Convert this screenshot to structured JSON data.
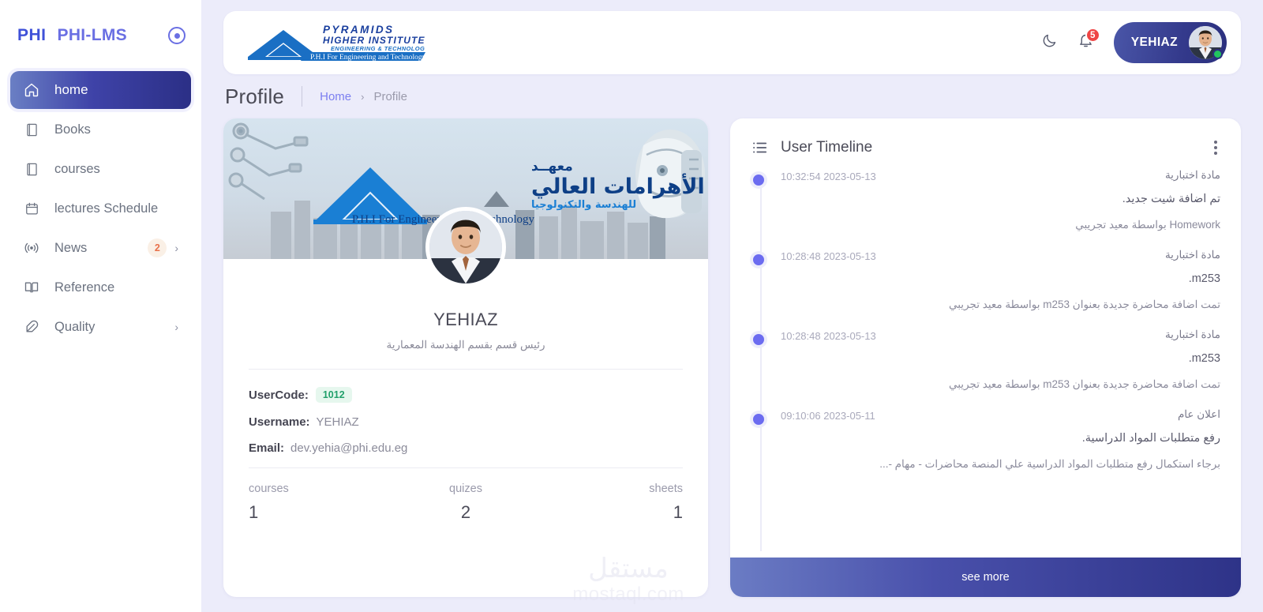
{
  "sidebar": {
    "brand_short": "PHI",
    "brand_name": "PHI-LMS",
    "collapse_icon": "circle-dot-icon",
    "items": [
      {
        "label": "home",
        "icon": "home-icon",
        "active": true
      },
      {
        "label": "Books",
        "icon": "book-icon",
        "active": false
      },
      {
        "label": "courses",
        "icon": "book-icon",
        "active": false
      },
      {
        "label": "lectures Schedule",
        "icon": "calendar-icon",
        "active": false
      },
      {
        "label": "News",
        "icon": "broadcast-icon",
        "active": false,
        "badge": "2",
        "chevron": "chevron-right-icon"
      },
      {
        "label": "Reference",
        "icon": "open-book-icon",
        "active": false
      },
      {
        "label": "Quality",
        "icon": "feather-icon",
        "active": false,
        "chevron": "chevron-right-icon"
      }
    ]
  },
  "topbar": {
    "logo": {
      "line1": "PYRAMIDS",
      "line2": "HIGHER INSTITUTE",
      "line3": "ENGINEERING & TECHNOLOGY",
      "line4": "P.H.I For Engineering and Technology"
    },
    "dark_mode_icon": "moon-icon",
    "notifications_icon": "bell-icon",
    "notifications_count": "5",
    "user_name": "YEHIAZ",
    "avatar": "user-avatar",
    "status": "online"
  },
  "breadcrumb": {
    "page_title": "Profile",
    "home": "Home",
    "separator": "›",
    "current": "Profile"
  },
  "profile": {
    "banner": {
      "arabic_top": "معهــد",
      "arabic_main": "الأهرامات العالي",
      "arabic_sub": "للهندسة والتكنولوجيا",
      "english": "P.H.I For Engineering and Technology"
    },
    "name": "YEHIAZ",
    "role": "رئيس قسم بقسم الهندسة المعمارية",
    "fields": {
      "usercode_label": "UserCode:",
      "usercode_value": "1012",
      "username_label": "Username:",
      "username_value": "YEHIAZ",
      "email_label": "Email:",
      "email_value": "dev.yehia@phi.edu.eg"
    },
    "stats": [
      {
        "label": "courses",
        "value": "1"
      },
      {
        "label": "quizes",
        "value": "2"
      },
      {
        "label": "sheets",
        "value": "1"
      }
    ]
  },
  "timeline": {
    "icon": "list-icon",
    "title": "User Timeline",
    "menu_icon": "more-vertical-icon",
    "items": [
      {
        "time": "10:32:54 2023-05-13",
        "category": "مادة اختبارية",
        "subject": "تم اضافة شيت جديد.",
        "description": "Homework بواسطة معيد تجريبي"
      },
      {
        "time": "10:28:48 2023-05-13",
        "category": "مادة اختبارية",
        "subject": "m253.",
        "description": "تمت اضافة محاضرة جديدة بعنوان m253 بواسطة معيد تجريبي"
      },
      {
        "time": "10:28:48 2023-05-13",
        "category": "مادة اختبارية",
        "subject": "m253.",
        "description": "تمت اضافة محاضرة جديدة بعنوان m253 بواسطة معيد تجريبي"
      },
      {
        "time": "09:10:06 2023-05-11",
        "category": "اعلان عام",
        "subject": "رفع متطلبات المواد الدراسية.",
        "description": "برجاء استكمال رفع متطلبات المواد الدراسية علي المنصة محاضرات - مهام -..."
      }
    ],
    "see_more": "see more"
  },
  "watermark": {
    "arabic": "مستقل",
    "english": "mostaql.com"
  },
  "colors": {
    "accent": "#6c6cf0",
    "sidebar_active": "#2b2f86",
    "badge_red": "#ef4444",
    "badge_green": "#22a06b",
    "online_green": "#22c55e",
    "page_bg": "#ececfa"
  }
}
